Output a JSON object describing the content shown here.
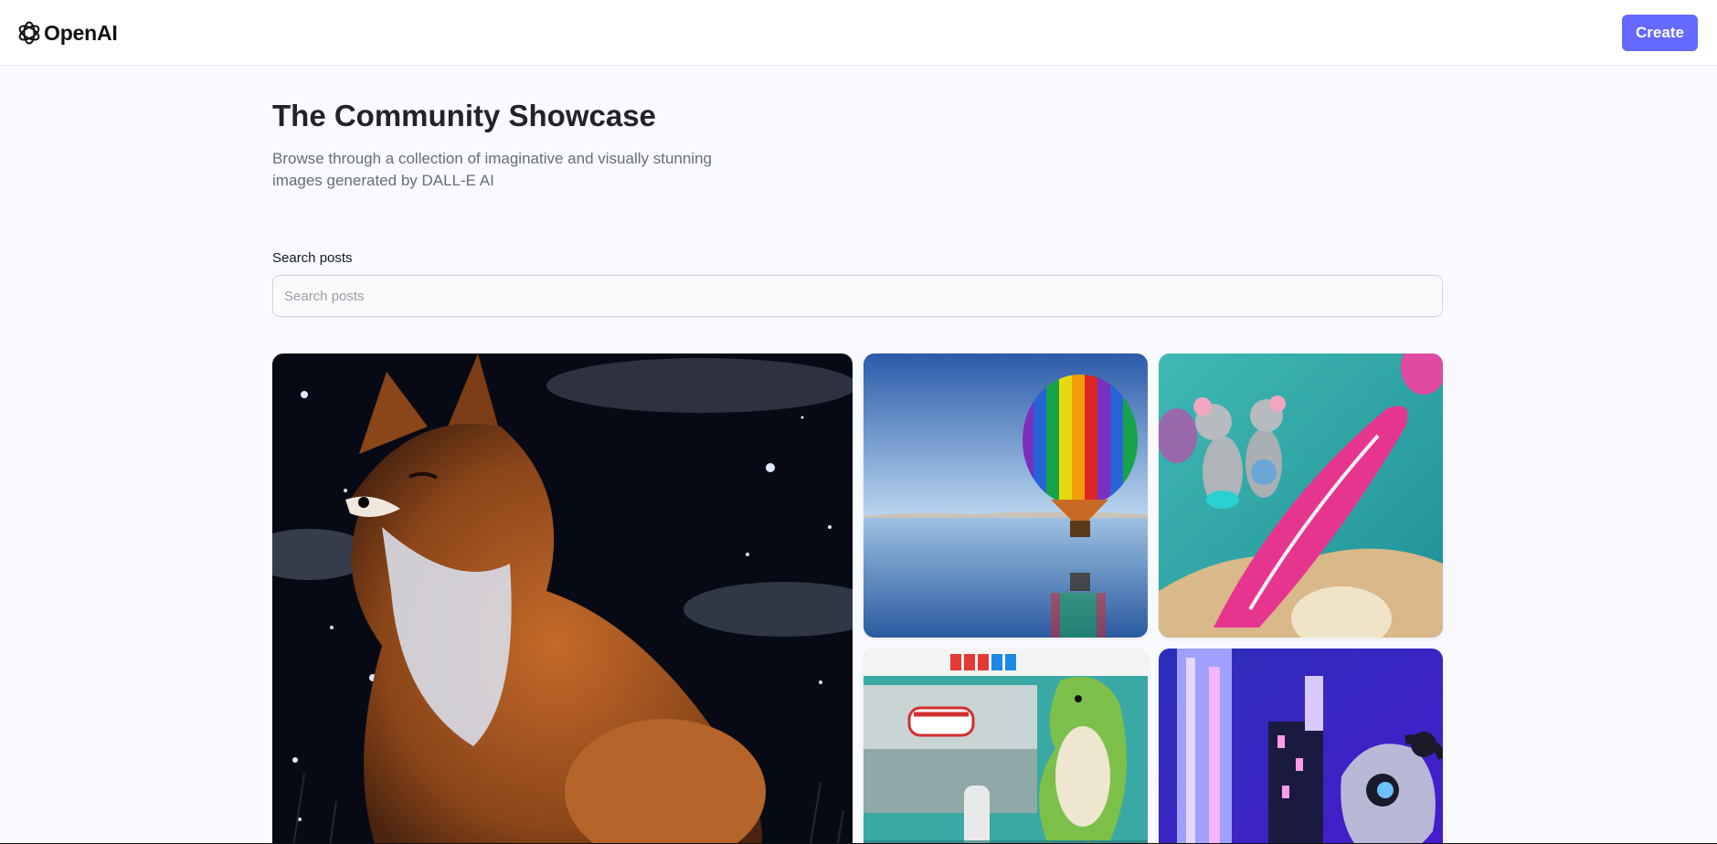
{
  "header": {
    "logo_text": "OpenAI",
    "logo_icon": "openai-logo-icon",
    "create_label": "Create"
  },
  "main": {
    "title": "The Community Showcase",
    "subtitle": "Browse through a collection of imaginative and visually stunning images generated by DALL-E AI"
  },
  "search": {
    "label": "Search posts",
    "placeholder": "Search posts",
    "value": ""
  },
  "gallery": [
    {
      "name": "fox-painting-image"
    },
    {
      "name": "hot-air-balloon-image"
    },
    {
      "name": "mice-surfboard-image"
    },
    {
      "name": "dinosaur-toy-image"
    },
    {
      "name": "robot-neon-city-image"
    }
  ],
  "colors": {
    "accent": "#6469ff",
    "background": "#f9fafe",
    "title": "#222328",
    "subtitle": "#666e75"
  }
}
